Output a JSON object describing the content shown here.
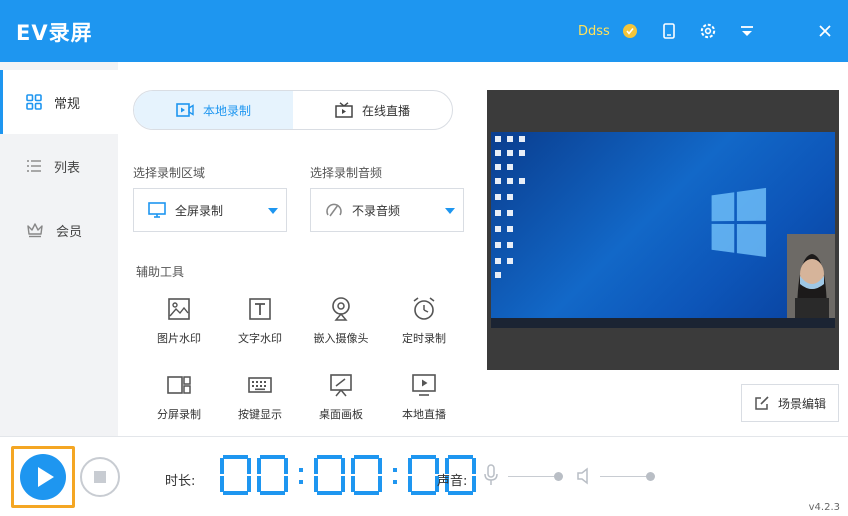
{
  "app": {
    "title": "EV录屏",
    "user": "Ddss",
    "version": "v4.2.3"
  },
  "sidebar": {
    "items": [
      {
        "label": "常规",
        "icon": "grid-icon",
        "active": true
      },
      {
        "label": "列表",
        "icon": "list-icon",
        "active": false
      },
      {
        "label": "会员",
        "icon": "crown-icon",
        "active": false
      }
    ]
  },
  "tabs": [
    {
      "label": "本地录制",
      "active": true
    },
    {
      "label": "在线直播",
      "active": false
    }
  ],
  "record_area": {
    "label": "选择录制区域",
    "value": "全屏录制"
  },
  "record_audio": {
    "label": "选择录制音频",
    "value": "不录音频"
  },
  "tools": {
    "label": "辅助工具",
    "items": [
      {
        "label": "图片水印"
      },
      {
        "label": "文字水印"
      },
      {
        "label": "嵌入摄像头"
      },
      {
        "label": "定时录制"
      },
      {
        "label": "分屏录制"
      },
      {
        "label": "按键显示"
      },
      {
        "label": "桌面画板"
      },
      {
        "label": "本地直播"
      }
    ]
  },
  "scene_edit": "场景编辑",
  "bottom": {
    "duration_label": "时长:",
    "timer": [
      "0",
      "0",
      "0",
      "0",
      "0",
      "0"
    ],
    "volume_label": "声音:"
  },
  "colors": {
    "accent": "#1e96f0",
    "user": "#ffe25a",
    "highlight": "#f4a623"
  }
}
